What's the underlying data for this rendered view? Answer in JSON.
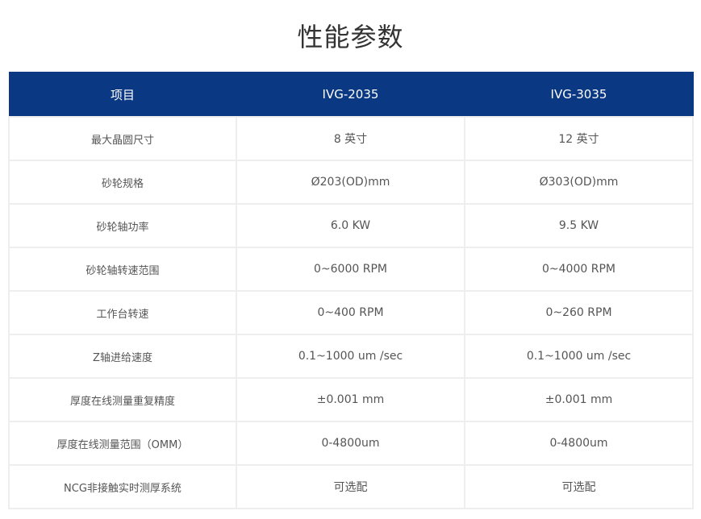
{
  "title": "性能参数",
  "table": {
    "headers": [
      "项目",
      "IVG-2035",
      "IVG-3035"
    ],
    "rows": [
      [
        "最大晶圆尺寸",
        "8 英寸",
        "12 英寸"
      ],
      [
        "砂轮规格",
        "Ø203(OD)mm",
        "Ø303(OD)mm"
      ],
      [
        "砂轮轴功率",
        "6.0 KW",
        "9.5 KW"
      ],
      [
        "砂轮轴转速范围",
        "0~6000 RPM",
        "0~4000 RPM"
      ],
      [
        "工作台转速",
        "0~400 RPM",
        "0~260 RPM"
      ],
      [
        "Z轴进给速度",
        "0.1~1000 um /sec",
        "0.1~1000 um /sec"
      ],
      [
        "厚度在线测量重复精度",
        "±0.001 mm",
        "±0.001 mm"
      ],
      [
        "厚度在线测量范围（OMM）",
        "0-4800um",
        "0-4800um"
      ],
      [
        "NCG非接触实时测厚系统",
        "可选配",
        "可选配"
      ]
    ]
  },
  "colors": {
    "header_bg": "#0b3883",
    "header_text": "#ffffff",
    "cell_border": "#eeeeee",
    "body_text": "#555555"
  }
}
